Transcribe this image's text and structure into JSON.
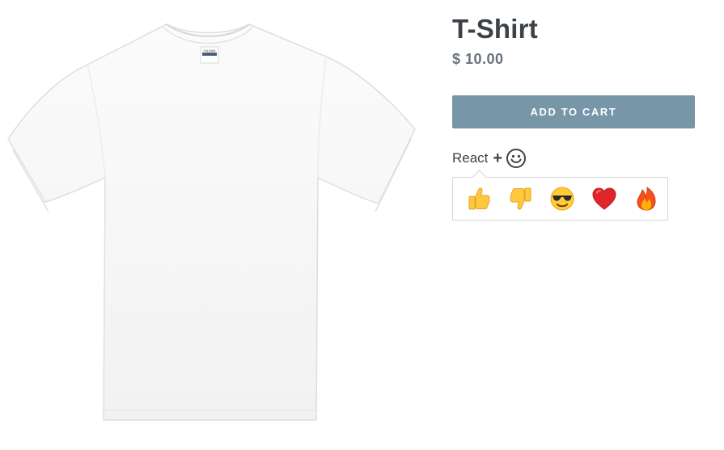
{
  "product": {
    "title": "T-Shirt",
    "price": "$ 10.00",
    "add_to_cart_label": "ADD TO CART",
    "image_icon": "white-tshirt-icon",
    "tag_label": "GILDAN"
  },
  "react": {
    "label": "React",
    "plus": "+",
    "trigger_icon": "smiley-icon",
    "reactions": [
      {
        "icon": "thumbs-up-icon"
      },
      {
        "icon": "thumbs-down-icon"
      },
      {
        "icon": "sunglasses-face-icon"
      },
      {
        "icon": "heart-icon"
      },
      {
        "icon": "fire-icon"
      }
    ]
  },
  "colors": {
    "button": "#7796a8",
    "title": "#3d4246",
    "price": "#69727b",
    "panel_border": "#d4d4d4"
  }
}
